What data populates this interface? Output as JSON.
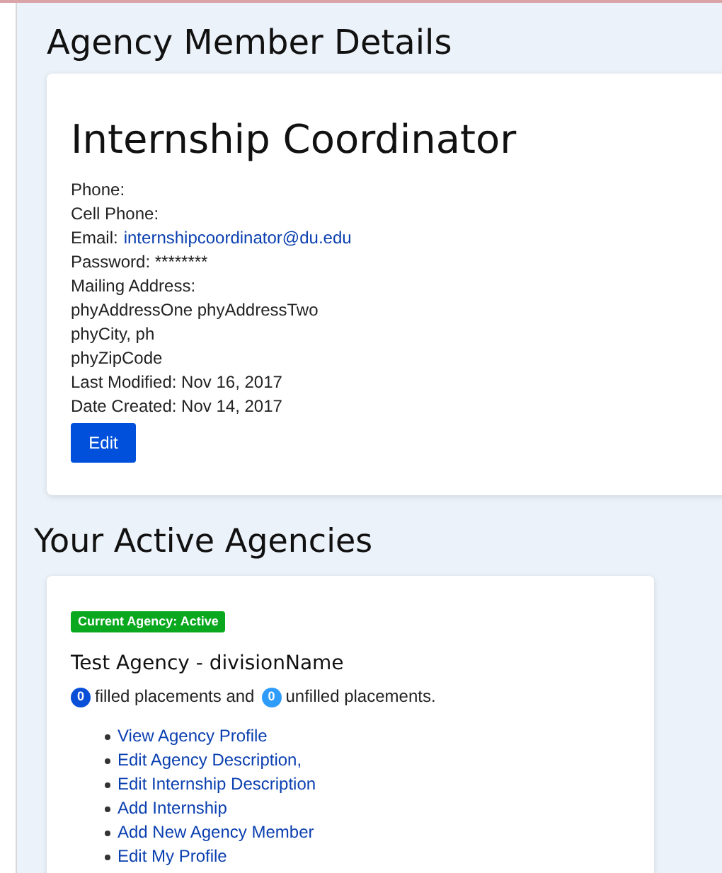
{
  "member_section": {
    "heading": "Agency Member Details",
    "name": "Internship Coordinator",
    "lines": [
      {
        "kind": "text",
        "text": "Phone:"
      },
      {
        "kind": "text",
        "text": "Cell Phone:"
      },
      {
        "kind": "link",
        "text": "Email:",
        "link": "internshipcoordinator@du.edu"
      },
      {
        "kind": "text",
        "text": "Password: ********"
      },
      {
        "kind": "text",
        "text": "Mailing Address:"
      },
      {
        "kind": "text",
        "text": "phyAddressOne phyAddressTwo"
      },
      {
        "kind": "text",
        "text": "phyCity, ph"
      },
      {
        "kind": "text",
        "text": "phyZipCode"
      },
      {
        "kind": "text",
        "text": "Last Modified: Nov 16, 2017"
      },
      {
        "kind": "text",
        "text": "Date Created: Nov 14, 2017"
      }
    ],
    "button": "Edit"
  },
  "agencies_section": {
    "heading": "Your Active Agencies",
    "agency": {
      "status_badge": "Current Agency: Active",
      "name": "Test Agency - divisionName",
      "placements": [
        {
          "kind": "badge",
          "text": "0",
          "color": "#0a4fd8"
        },
        {
          "kind": "text",
          "text": "filled placements and"
        },
        {
          "kind": "badge",
          "text": "0",
          "color": "#2e9cfb"
        },
        {
          "kind": "text",
          "text": "unfilled placements."
        }
      ],
      "links": [
        "View Agency Profile",
        "Edit Agency Description,",
        "Edit Internship Description",
        "Add Internship",
        "Add New Agency Member",
        "Edit My Profile"
      ]
    }
  }
}
